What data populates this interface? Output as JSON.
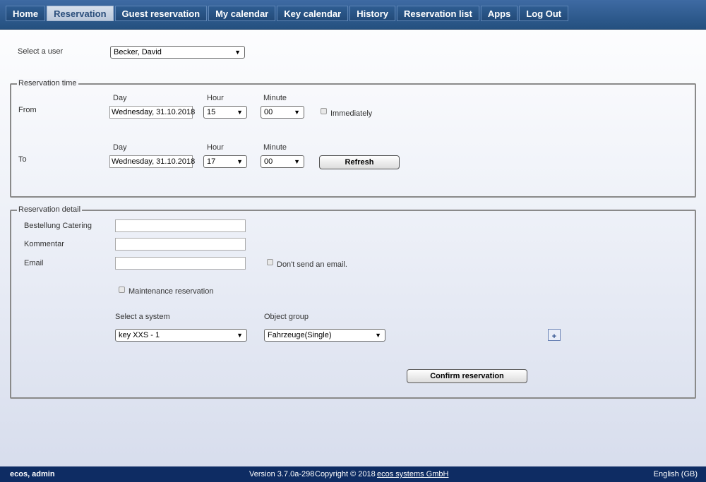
{
  "nav": {
    "items": [
      {
        "label": "Home"
      },
      {
        "label": "Reservation"
      },
      {
        "label": "Guest reservation"
      },
      {
        "label": "My calendar"
      },
      {
        "label": "Key calendar"
      },
      {
        "label": "History"
      },
      {
        "label": "Reservation list"
      },
      {
        "label": "Apps"
      },
      {
        "label": "Log Out"
      }
    ],
    "active": "Reservation"
  },
  "user": {
    "label": "Select a user",
    "selected": "Becker, David"
  },
  "reservation_time": {
    "legend": "Reservation time",
    "day_label": "Day",
    "hour_label": "Hour",
    "minute_label": "Minute",
    "from": {
      "label": "From",
      "day": "Wednesday, 31.10.2018",
      "hour": "15",
      "minute": "00",
      "immediately_label": "Immediately",
      "immediately_checked": false
    },
    "to": {
      "label": "To",
      "day": "Wednesday, 31.10.2018",
      "hour": "17",
      "minute": "00"
    },
    "refresh_label": "Refresh"
  },
  "reservation_detail": {
    "legend": "Reservation detail",
    "catering_label": "Bestellung Catering",
    "catering_value": "",
    "comment_label": "Kommentar",
    "comment_value": "",
    "email_label": "Email",
    "email_value": "",
    "dont_send_email_label": "Don't send an email.",
    "dont_send_email_checked": false,
    "maintenance_label": "Maintenance reservation",
    "maintenance_checked": false,
    "system_label": "Select a system",
    "system_selected": "key XXS - 1",
    "object_group_label": "Object group",
    "object_group_selected": "Fahrzeuge(Single)",
    "add_symbol": "+",
    "confirm_label": "Confirm reservation"
  },
  "footer": {
    "user": "ecos, admin",
    "version": "Version 3.7.0a-298",
    "copyright": "Copyright © 2018",
    "company": "ecos systems GmbH",
    "language": "English (GB)"
  },
  "icons": {
    "dropdown": "chevron-down-icon",
    "add": "plus-icon"
  },
  "colors": {
    "nav_bg": "#2c5a8f",
    "nav_active_bg": "#c9d5e6",
    "footer_bg": "#0e2c63",
    "border": "#8a8a8a"
  }
}
